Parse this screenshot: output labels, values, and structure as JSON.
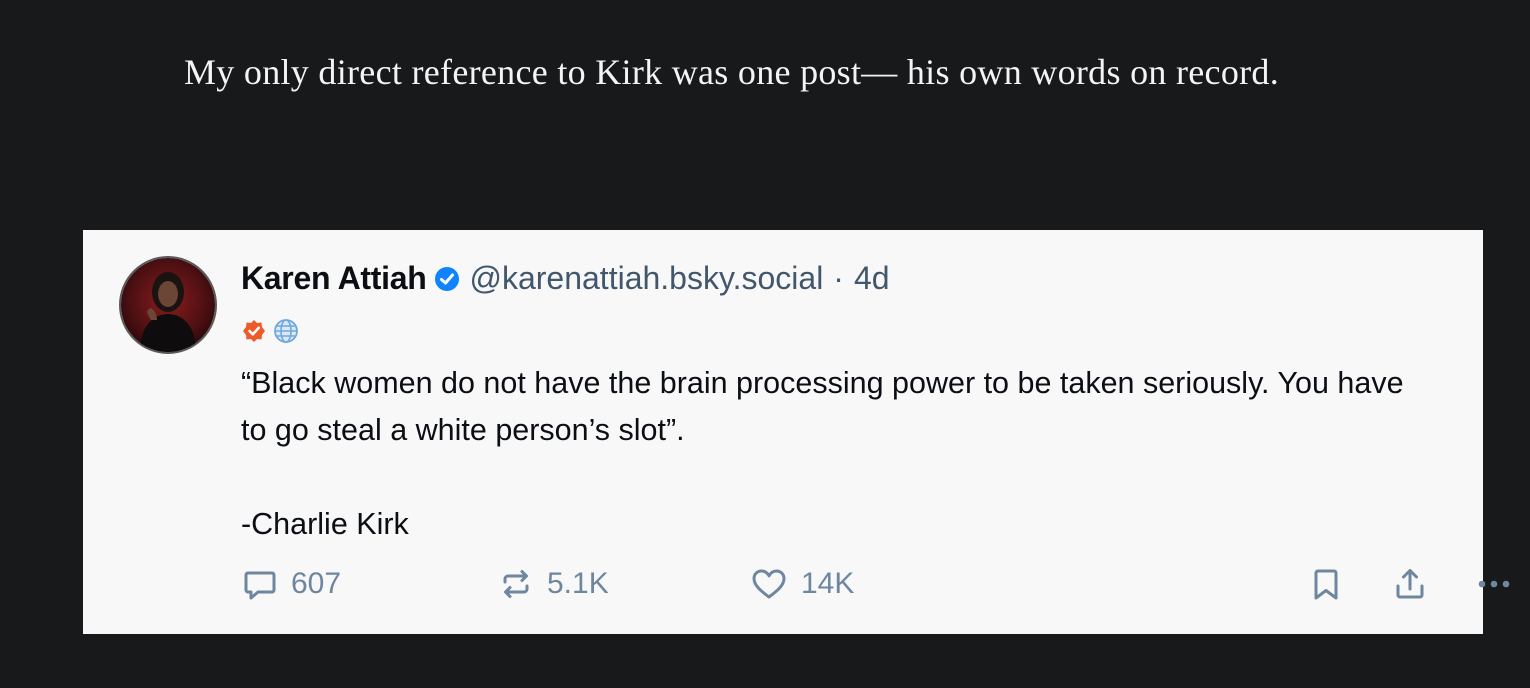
{
  "article": {
    "intro_text": "My only direct reference to Kirk was one post— his own words on record."
  },
  "post": {
    "author": {
      "display_name": "Karen Attiah",
      "handle": "@karenattiah.bsky.social",
      "verified": true,
      "badges": [
        "verified-check-badge",
        "globe-icon"
      ]
    },
    "separator": "·",
    "timestamp": "4d",
    "text": "“Black women do not have the brain processing power to be taken seriously. You have to go steal a white person’s slot”.\n\n-Charlie Kirk",
    "stats": {
      "replies": "607",
      "reposts": "5.1K",
      "likes": "14K"
    },
    "icons": [
      "reply-icon",
      "repost-icon",
      "like-icon",
      "bookmark-icon",
      "share-icon",
      "more-icon"
    ]
  },
  "colors": {
    "page_background": "#18191b",
    "card_background": "#f8f8f9",
    "text_primary": "#0b0f14",
    "text_muted": "#42576c",
    "action_icons": "#6f869f",
    "verified_blue": "#1083fe",
    "badge_orange": "#ef5a2a",
    "globe_blue": "#6fa8dc"
  }
}
